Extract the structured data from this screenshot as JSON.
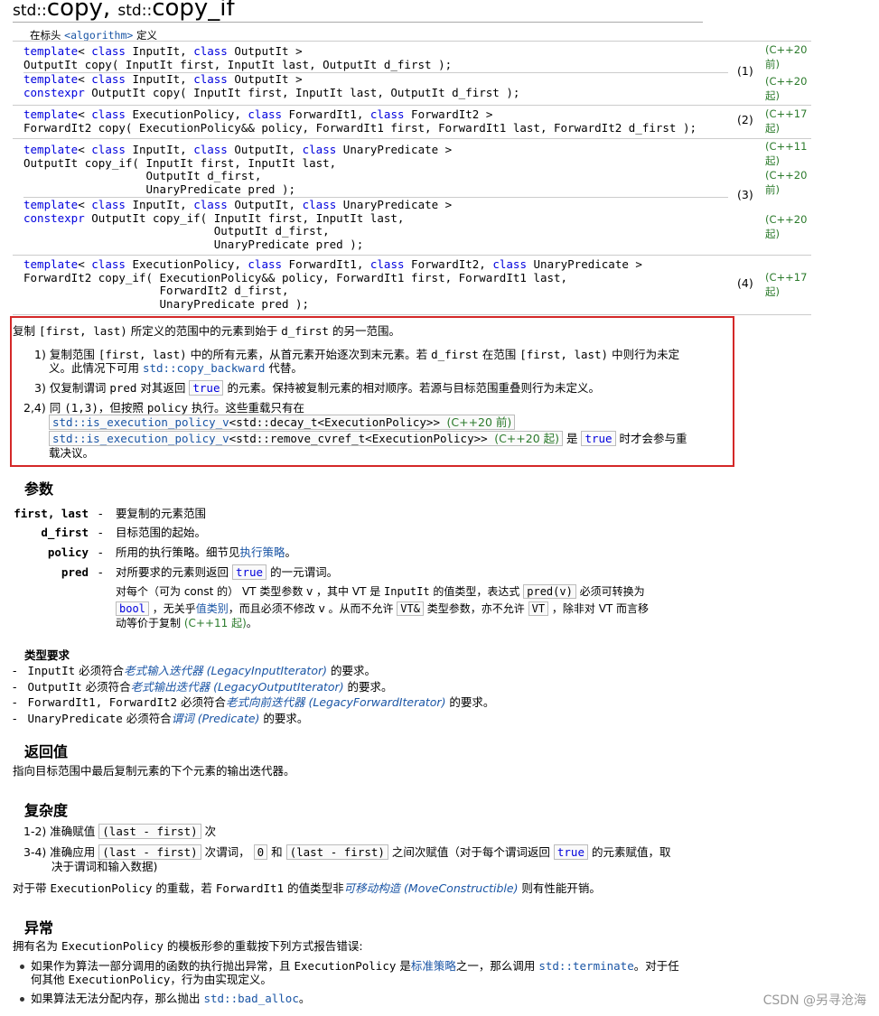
{
  "title": {
    "p1": "std::",
    "b1": "copy",
    "sep": ", ",
    "p2": "std::",
    "b2": "copy_if"
  },
  "header_note": {
    "pre": "在标头 ",
    "hdr": "<algorithm>",
    "post": " 定义"
  },
  "declarations": [
    {
      "line1": "template< class InputIt, class OutputIt >",
      "line2": "OutputIt copy( InputIt first, InputIt last, OutputIt d_first );"
    },
    {
      "line1": "template< class InputIt, class OutputIt >",
      "line2": "constexpr OutputIt copy( InputIt first, InputIt last, OutputIt d_first );"
    },
    {
      "line1": "template< class ExecutionPolicy, class ForwardIt1, class ForwardIt2 >",
      "line2": "ForwardIt2 copy( ExecutionPolicy&& policy, ForwardIt1 first, ForwardIt1 last, ForwardIt2 d_first );"
    },
    {
      "line1": "template< class InputIt, class OutputIt, class UnaryPredicate >",
      "line2": "OutputIt copy_if( InputIt first, InputIt last,",
      "line3": "                  OutputIt d_first,",
      "line4": "                  UnaryPredicate pred );"
    },
    {
      "line1": "template< class InputIt, class OutputIt, class UnaryPredicate >",
      "line2": "constexpr OutputIt copy_if( InputIt first, InputIt last,",
      "line3": "                            OutputIt d_first,",
      "line4": "                            UnaryPredicate pred );"
    },
    {
      "line1": "template< class ExecutionPolicy, class ForwardIt1, class ForwardIt2, class UnaryPredicate >",
      "line2": "ForwardIt2 copy_if( ExecutionPolicy&& policy, ForwardIt1 first, ForwardIt1 last,",
      "line3": "                    ForwardIt2 d_first,",
      "line4": "                    UnaryPredicate pred );"
    }
  ],
  "versions": [
    "(C++20",
    "前)",
    "(C++20",
    "起)",
    "(C++17",
    "起)",
    "(C++11",
    "起)",
    "(C++20",
    "前)",
    "(C++20",
    "起)",
    "(C++17",
    "起)"
  ],
  "numbers": [
    "(1)",
    "(2)",
    "(3)",
    "(4)"
  ],
  "description": {
    "intro_a": "复制 ",
    "intro_code": "[first, last)",
    "intro_b": " 所定义的范围中的元素到始于 ",
    "intro_code2": "d_first",
    "intro_c": " 的另一范围。",
    "i1_label": "1)",
    "i1_a": "复制范围 ",
    "i1_code": "[first, last)",
    "i1_b": " 中的所有元素，从首元素开始逐次到末元素。若 ",
    "i1_code2": "d_first",
    "i1_c": " 在范围 ",
    "i1_code3": "[first, last)",
    "i1_d": " 中则行为未定",
    "i1_e": "义。此情况下可用 ",
    "i1_link": "std::copy_backward",
    "i1_f": " 代替。",
    "i3_label": "3)",
    "i3_a": "仅复制谓词 ",
    "i3_code": "pred",
    "i3_b": " 对其返回 ",
    "i3_true": "true",
    "i3_c": " 的元素。保持被复制元素的相对顺序。若源与目标范围重叠则行为未定义。",
    "i24_label": "2,4)",
    "i24_a": "同 ",
    "i24_code": "(1,3)",
    "i24_b": "，但按照 ",
    "i24_code2": "policy",
    "i24_c": " 执行。这些重载只有在",
    "cond1_link": "std::is_execution_policy_v",
    "cond1_rest": "<std::decay_t<ExecutionPolicy>>",
    "cond1_ver": "(C++20 前)",
    "cond2_link": "std::is_execution_policy_v",
    "cond2_rest": "<std::remove_cvref_t<ExecutionPolicy>>",
    "cond2_ver": "(C++20 起)",
    "cond_a": " 是 ",
    "cond_true": "true",
    "cond_b": " 时才会参与重",
    "cond_c": "载决议。"
  },
  "params": {
    "heading": "参数",
    "p1_name": "first, last",
    "p1_desc": "要复制的元素范围",
    "p2_name": "d_first",
    "p2_desc": "目标范围的起始。",
    "p3_name": "policy",
    "p3_desc_a": "所用的执行策略。细节见",
    "p3_link": "执行策略",
    "p3_desc_b": "。",
    "p4_name": "pred",
    "p4_desc_a": "对所要求的元素则返回 ",
    "p4_true": "true",
    "p4_desc_b": " 的一元谓词。",
    "p4_more_a": "对每个（可为 const 的） ",
    "p4_more_v": "VT",
    "p4_more_b": " 类型参数 v ，其中 VT 是 ",
    "p4_more_c": "InputIt",
    "p4_more_d": " 的值类型，表达式 ",
    "p4_more_e": "pred(v)",
    "p4_more_f": " 必须可转换为",
    "p4_l2_a": "bool",
    "p4_l2_b": " ，无关乎",
    "p4_l2_link": "值类别",
    "p4_l2_c": "，而且必须不修改 v 。从而不允许 ",
    "p4_l2_d": "VT&",
    "p4_l2_e": " 类型参数，亦不允许 ",
    "p4_l2_f": "VT",
    "p4_l2_g": " ，除非对 VT 而言移",
    "p4_l3_a": "动等价于复制 ",
    "p4_l3_ver": "(C++11 起)",
    "p4_l3_b": "。",
    "dash": "-"
  },
  "type_req": {
    "heading": "类型要求",
    "items": [
      {
        "dash": "-",
        "code": "InputIt",
        "a": " 必须符合",
        "link": "老式输入迭代器 (LegacyInputIterator)",
        "b": " 的要求。"
      },
      {
        "dash": "-",
        "code": "OutputIt",
        "a": " 必须符合",
        "link": "老式输出迭代器 (LegacyOutputIterator)",
        "b": " 的要求。"
      },
      {
        "dash": "-",
        "code": "ForwardIt1, ForwardIt2",
        "a": " 必须符合",
        "link": "老式向前迭代器 (LegacyForwardIterator)",
        "b": " 的要求。"
      },
      {
        "dash": "-",
        "code": "UnaryPredicate",
        "a": " 必须符合",
        "link": "谓词 (Predicate)",
        "b": " 的要求。"
      }
    ]
  },
  "return_value": {
    "heading": "返回值",
    "text": "指向目标范围中最后复制元素的下个元素的输出迭代器。"
  },
  "complexity": {
    "heading": "复杂度",
    "c1_label": "1-2)",
    "c1_a": "准确赋值 ",
    "c1_code": "(last - first)",
    "c1_b": " 次",
    "c2_label": "3-4)",
    "c2_a": "准确应用 ",
    "c2_code": "(last - first)",
    "c2_b": " 次谓词， ",
    "c2_zero": "0",
    "c2_c": " 和 ",
    "c2_code2": "(last - first)",
    "c2_d": " 之间次赋值（对于每个谓词返回 ",
    "c2_true": "true",
    "c2_e": " 的元素赋值，取",
    "c2_f": "决于谓词和输入数据)",
    "note_a": "对于带 ",
    "note_code": "ExecutionPolicy",
    "note_b": " 的重载，若 ",
    "note_code2": "ForwardIt1",
    "note_c": " 的值类型非",
    "note_link": "可移动构造 (MoveConstructible)",
    "note_d": " 则有性能开销。"
  },
  "exceptions": {
    "heading": "异常",
    "intro_a": "拥有名为 ",
    "intro_code": "ExecutionPolicy",
    "intro_b": " 的模板形参的重载按下列方式报告错误:",
    "b1_a": "如果作为算法一部分调用的函数的执行抛出异常，且 ",
    "b1_code": "ExecutionPolicy",
    "b1_b": " 是",
    "b1_link": "标准策略",
    "b1_c": "之一，那么调用 ",
    "b1_link2": "std::terminate",
    "b1_d": "。对于任",
    "b1_e": "何其他 ",
    "b1_code2": "ExecutionPolicy",
    "b1_f": "，行为由实现定义。",
    "b2_a": "如果算法无法分配内存，那么抛出 ",
    "b2_link": "std::bad_alloc",
    "b2_b": "。"
  },
  "watermark": "CSDN @另寻沧海"
}
